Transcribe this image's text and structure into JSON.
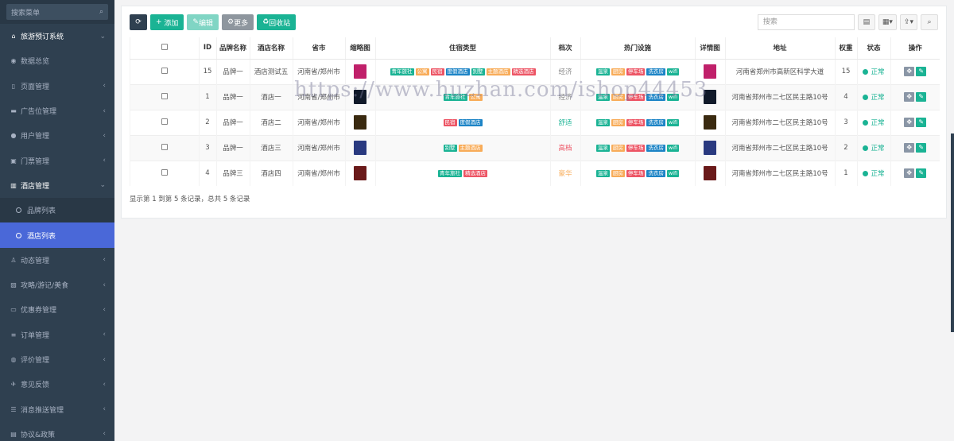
{
  "sidebar": {
    "search_placeholder": "搜索菜单",
    "items": [
      {
        "label": "旅游预订系统",
        "icon": "home-icon",
        "bold": true,
        "arrow": "⌄"
      },
      {
        "label": "数据总览",
        "icon": "dashboard-icon",
        "arrow": ""
      },
      {
        "label": "页面管理",
        "icon": "bookmark-icon",
        "arrow": "‹"
      },
      {
        "label": "广告位管理",
        "icon": "card-icon",
        "arrow": "‹"
      },
      {
        "label": "用户管理",
        "icon": "user-icon",
        "arrow": "‹"
      },
      {
        "label": "门票管理",
        "icon": "ticket-icon",
        "arrow": "‹"
      },
      {
        "label": "酒店管理",
        "icon": "building-icon",
        "bold": true,
        "arrow": "⌄"
      },
      {
        "label": "品牌列表",
        "sub": true
      },
      {
        "label": "酒店列表",
        "sub": true,
        "active": true
      },
      {
        "label": "动态管理",
        "icon": "walk-icon",
        "arrow": "‹"
      },
      {
        "label": "攻略/游记/美食",
        "icon": "image-icon",
        "arrow": "‹"
      },
      {
        "label": "优惠券管理",
        "icon": "coupon-icon",
        "arrow": "‹"
      },
      {
        "label": "订单管理",
        "icon": "list-icon",
        "arrow": "‹"
      },
      {
        "label": "评价管理",
        "icon": "comment-icon",
        "arrow": "‹"
      },
      {
        "label": "意见反馈",
        "icon": "feedback-icon",
        "arrow": "‹"
      },
      {
        "label": "消息推送管理",
        "icon": "message-icon",
        "arrow": "‹"
      },
      {
        "label": "协议&政策",
        "icon": "doc-icon",
        "arrow": "‹"
      }
    ]
  },
  "toolbar": {
    "add": "添加",
    "edit": "编辑",
    "more": "更多",
    "bin": "回收站",
    "search_placeholder": "搜索"
  },
  "table": {
    "headers": [
      "ID",
      "品牌名称",
      "酒店名称",
      "省市",
      "缩略图",
      "住宿类型",
      "档次",
      "热门设施",
      "详情图",
      "地址",
      "权重",
      "状态",
      "操作"
    ],
    "rows": [
      {
        "id": "15",
        "brand": "品牌一",
        "name": "酒店测试五",
        "city": "河南省/郑州市",
        "types": [
          "青年旅社",
          "公寓",
          "民宿",
          "度假酒店",
          "别墅",
          "主题酒店",
          "精选酒店"
        ],
        "grade": "经济",
        "gradeColor": "#888",
        "address": "河南省郑州市高新区科学大道",
        "weight": "15",
        "status": "正常",
        "thumb": "#c0206a"
      },
      {
        "id": "1",
        "brand": "品牌一",
        "name": "酒店一",
        "city": "河南省/郑州市",
        "types": [
          "青年旅社",
          "公寓"
        ],
        "grade": "经济",
        "gradeColor": "#888",
        "address": "河南省郑州市二七区民主路10号",
        "weight": "4",
        "status": "正常",
        "thumb": "#111a2a"
      },
      {
        "id": "2",
        "brand": "品牌一",
        "name": "酒店二",
        "city": "河南省/郑州市",
        "types": [
          "民宿",
          "度假酒店"
        ],
        "grade": "舒适",
        "gradeColor": "#1ab394",
        "address": "河南省郑州市二七区民主路10号",
        "weight": "3",
        "status": "正常",
        "thumb": "#3a2a10"
      },
      {
        "id": "3",
        "brand": "品牌一",
        "name": "酒店三",
        "city": "河南省/郑州市",
        "types": [
          "别墅",
          "主题酒店"
        ],
        "grade": "高档",
        "gradeColor": "#ed5565",
        "address": "河南省郑州市二七区民主路10号",
        "weight": "2",
        "status": "正常",
        "thumb": "#2a3a80"
      },
      {
        "id": "4",
        "brand": "品牌三",
        "name": "酒店四",
        "city": "河南省/郑州市",
        "types": [
          "青年旅社",
          "精选酒店"
        ],
        "grade": "豪华",
        "gradeColor": "#f8ac59",
        "address": "河南省郑州市二七区民主路10号",
        "weight": "1",
        "status": "正常",
        "thumb": "#6a1a1a"
      }
    ],
    "facilities": [
      "温泉",
      "厨房",
      "停车场",
      "洗衣房",
      "wifi"
    ]
  },
  "footer": "显示第 1 到第 5 条记录，总共 5 条记录",
  "watermark": "https://www.huzhan.com/ishop44453",
  "colors": {
    "tags": {
      "青年旅社": "#1ab394",
      "公寓": "#f8ac59",
      "民宿": "#ed5565",
      "度假酒店": "#1c84c6",
      "别墅": "#1ab394",
      "主题酒店": "#f8ac59",
      "精选酒店": "#ed5565"
    },
    "facilities": {
      "温泉": "#1ab394",
      "厨房": "#f8ac59",
      "停车场": "#ed5565",
      "洗衣房": "#1c84c6",
      "wifi": "#1ab394"
    }
  }
}
